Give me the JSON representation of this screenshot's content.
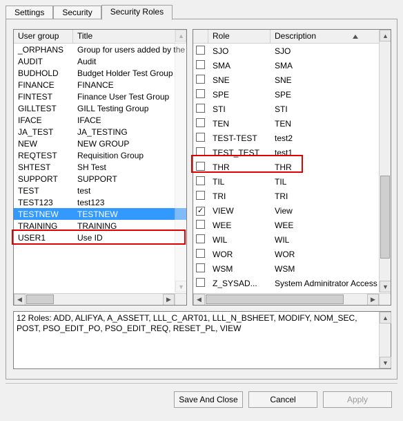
{
  "tabs": [
    "Settings",
    "Security",
    "Security Roles"
  ],
  "active_tab_index": 2,
  "left": {
    "headers": [
      "User group",
      "Title"
    ],
    "rows": [
      {
        "group": "_ORPHANS",
        "title": "Group for users added by the system",
        "selected": false
      },
      {
        "group": "AUDIT",
        "title": "Audit",
        "selected": false
      },
      {
        "group": "BUDHOLD",
        "title": "Budget Holder Test Group",
        "selected": false
      },
      {
        "group": "FINANCE",
        "title": "FINANCE",
        "selected": false
      },
      {
        "group": "FINTEST",
        "title": "Finance User Test Group",
        "selected": false
      },
      {
        "group": "GILLTEST",
        "title": "GILL Testing Group",
        "selected": false
      },
      {
        "group": "IFACE",
        "title": "IFACE",
        "selected": false
      },
      {
        "group": "JA_TEST",
        "title": "JA_TESTING",
        "selected": false
      },
      {
        "group": "NEW",
        "title": "NEW GROUP",
        "selected": false
      },
      {
        "group": "REQTEST",
        "title": "Requisition Group",
        "selected": false
      },
      {
        "group": "SHTEST",
        "title": "SH Test",
        "selected": false
      },
      {
        "group": "SUPPORT",
        "title": "SUPPORT",
        "selected": false
      },
      {
        "group": "TEST",
        "title": "test",
        "selected": false
      },
      {
        "group": "TEST123",
        "title": "test123",
        "selected": false
      },
      {
        "group": "TESTNEW",
        "title": "TESTNEW",
        "selected": true
      },
      {
        "group": "TRAINING",
        "title": "TRAINING",
        "selected": false
      },
      {
        "group": "USER1",
        "title": "Use ID",
        "selected": false
      }
    ]
  },
  "right": {
    "headers": [
      "Role",
      "Description"
    ],
    "rows": [
      {
        "role": "SJO",
        "desc": "SJO",
        "checked": false
      },
      {
        "role": "SMA",
        "desc": "SMA",
        "checked": false
      },
      {
        "role": "SNE",
        "desc": "SNE",
        "checked": false
      },
      {
        "role": "SPE",
        "desc": "SPE",
        "checked": false
      },
      {
        "role": "STI",
        "desc": "STI",
        "checked": false
      },
      {
        "role": "TEN",
        "desc": "TEN",
        "checked": false
      },
      {
        "role": "TEST-TEST",
        "desc": "test2",
        "checked": false
      },
      {
        "role": "TEST_TEST",
        "desc": "test1",
        "checked": false
      },
      {
        "role": "THR",
        "desc": "THR",
        "checked": false
      },
      {
        "role": "TIL",
        "desc": "TIL",
        "checked": false
      },
      {
        "role": "TRI",
        "desc": "TRI",
        "checked": false
      },
      {
        "role": "VIEW",
        "desc": "View",
        "checked": true
      },
      {
        "role": "WEE",
        "desc": "WEE",
        "checked": false
      },
      {
        "role": "WIL",
        "desc": "WIL",
        "checked": false
      },
      {
        "role": "WOR",
        "desc": "WOR",
        "checked": false
      },
      {
        "role": "WSM",
        "desc": "WSM",
        "checked": false
      },
      {
        "role": "Z_SYSAD...",
        "desc": "System Adminitrator Access",
        "checked": false
      }
    ]
  },
  "summary": "12 Roles: ADD, ALIFYA, A_ASSETT, LLL_C_ART01, LLL_N_BSHEET, MODIFY, NOM_SEC, POST, PSO_EDIT_PO, PSO_EDIT_REQ, RESET_PL, VIEW",
  "buttons": {
    "save": "Save And Close",
    "cancel": "Cancel",
    "apply": "Apply"
  }
}
